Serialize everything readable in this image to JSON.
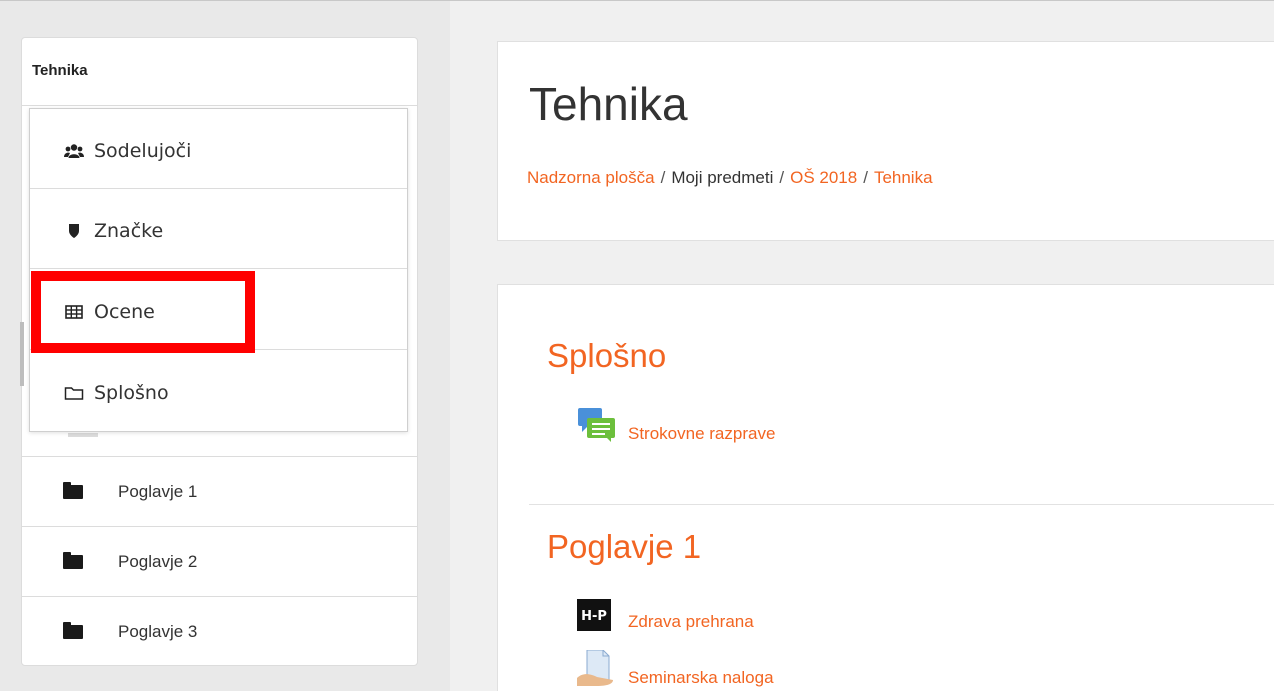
{
  "sidebar": {
    "title": "Tehnika",
    "items": [
      {
        "label": "Poglavje 1",
        "icon": "folder-icon"
      },
      {
        "label": "Poglavje 2",
        "icon": "folder-icon"
      },
      {
        "label": "Poglavje 3",
        "icon": "folder-icon"
      }
    ]
  },
  "dropdown": {
    "items": [
      {
        "label": "Sodelujoči",
        "icon": "users-icon"
      },
      {
        "label": "Značke",
        "icon": "shield-icon"
      },
      {
        "label": "Ocene",
        "icon": "table-icon"
      },
      {
        "label": "Splošno",
        "icon": "folder-outline-icon"
      }
    ]
  },
  "header": {
    "title": "Tehnika",
    "breadcrumb": [
      {
        "label": "Nadzorna plošča",
        "link": true
      },
      {
        "label": "Moji predmeti",
        "link": false
      },
      {
        "label": "OŠ 2018",
        "link": true
      },
      {
        "label": "Tehnika",
        "link": true
      }
    ],
    "breadcrumb_separator": "/"
  },
  "sections": [
    {
      "title": "Splošno",
      "activities": [
        {
          "label": "Strokovne razprave",
          "icon": "forum-icon"
        }
      ]
    },
    {
      "title": "Poglavje 1",
      "activities": [
        {
          "label": "Zdrava prehrana",
          "icon": "h5p-icon",
          "icon_text": "H-P"
        },
        {
          "label": "Seminarska naloga",
          "icon": "assignment-icon"
        }
      ]
    }
  ],
  "colors": {
    "accent": "#f26522",
    "highlight": "#ff0000",
    "text": "#333333"
  }
}
